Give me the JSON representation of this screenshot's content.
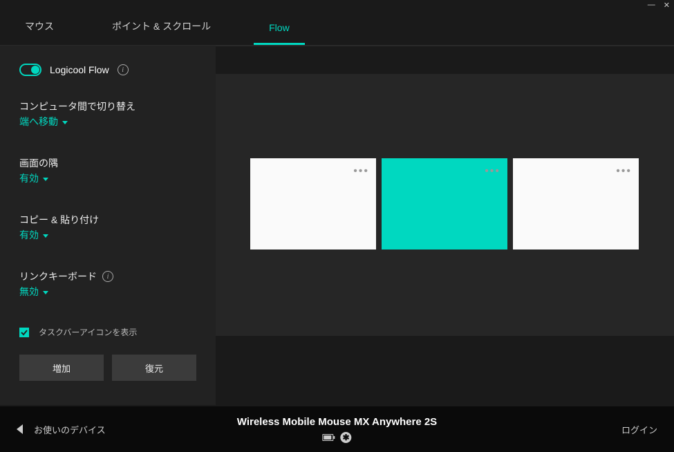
{
  "tabs": {
    "mouse": "マウス",
    "point_scroll": "ポイント & スクロール",
    "flow": "Flow"
  },
  "flow_toggle": {
    "label": "Logicool Flow",
    "on": true
  },
  "settings": {
    "switch": {
      "label": "コンピュータ間で切り替え",
      "value": "端へ移動"
    },
    "corners": {
      "label": "画面の隅",
      "value": "有効"
    },
    "copy_paste": {
      "label": "コピー & 貼り付け",
      "value": "有効"
    },
    "link_kb": {
      "label": "リンクキーボード",
      "value": "無効"
    }
  },
  "taskbar_checkbox": {
    "label": "タスクバーアイコンを表示",
    "checked": true
  },
  "buttons": {
    "add": "増加",
    "restore": "復元"
  },
  "screens": [
    {
      "active": false
    },
    {
      "active": true
    },
    {
      "active": false
    }
  ],
  "footer": {
    "back": "お使いのデバイス",
    "device": "Wireless Mobile Mouse MX Anywhere 2S",
    "login": "ログイン"
  },
  "colors": {
    "accent": "#00d8c0"
  }
}
